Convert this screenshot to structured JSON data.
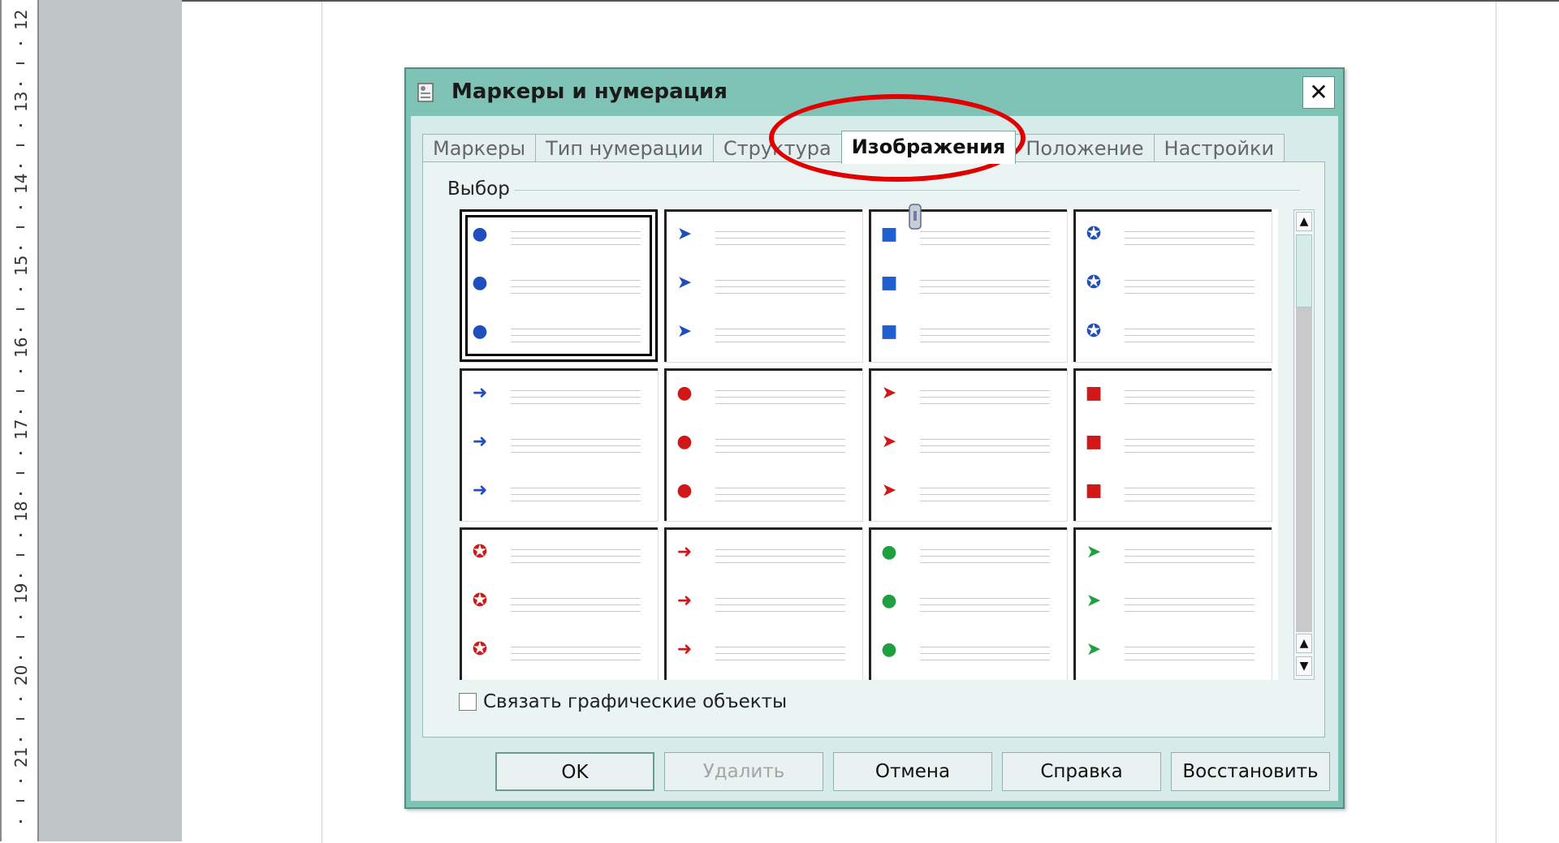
{
  "ruler": {
    "numbers": [
      "12",
      "13",
      "14",
      "15",
      "16",
      "17",
      "18",
      "19",
      "20",
      "21"
    ]
  },
  "dialog": {
    "title": "Маркеры и нумерация",
    "close_label": "✕",
    "tabs": [
      {
        "label": "Маркеры",
        "active": false
      },
      {
        "label": "Тип нумерации",
        "active": false
      },
      {
        "label": "Структура",
        "active": false
      },
      {
        "label": "Изображения",
        "active": true
      },
      {
        "label": "Положение",
        "active": false
      },
      {
        "label": "Настройки",
        "active": false
      }
    ],
    "group_label": "Выбор",
    "bullets": [
      {
        "icon": "blue-sphere-bullet",
        "color": "#1f4fbf",
        "glyph": "●",
        "selected": true
      },
      {
        "icon": "blue-diamond-arrow-bullet",
        "color": "#1f4fbf",
        "glyph": "➤"
      },
      {
        "icon": "blue-cube-bullet",
        "color": "#1f5fd0",
        "glyph": "■"
      },
      {
        "icon": "blue-star-bullet",
        "color": "#1f4fbf",
        "glyph": "✪"
      },
      {
        "icon": "blue-arrow-bullet",
        "color": "#1f4fbf",
        "glyph": "➜"
      },
      {
        "icon": "red-sphere-bullet",
        "color": "#d01818",
        "glyph": "●"
      },
      {
        "icon": "red-diamond-arrow-bullet",
        "color": "#d01818",
        "glyph": "➤"
      },
      {
        "icon": "red-cube-bullet",
        "color": "#d01818",
        "glyph": "■"
      },
      {
        "icon": "red-star-bullet",
        "color": "#d01818",
        "glyph": "✪"
      },
      {
        "icon": "red-arrow-bullet",
        "color": "#d01818",
        "glyph": "➜"
      },
      {
        "icon": "green-sphere-bullet",
        "color": "#1ea040",
        "glyph": "●"
      },
      {
        "icon": "green-diamond-arrow-bullet",
        "color": "#1ea040",
        "glyph": "➤"
      }
    ],
    "link_graphics_label": "Связать графические объекты",
    "buttons": {
      "ok": "OK",
      "delete": "Удалить",
      "cancel": "Отмена",
      "help": "Справка",
      "reset": "Восстановить"
    }
  }
}
